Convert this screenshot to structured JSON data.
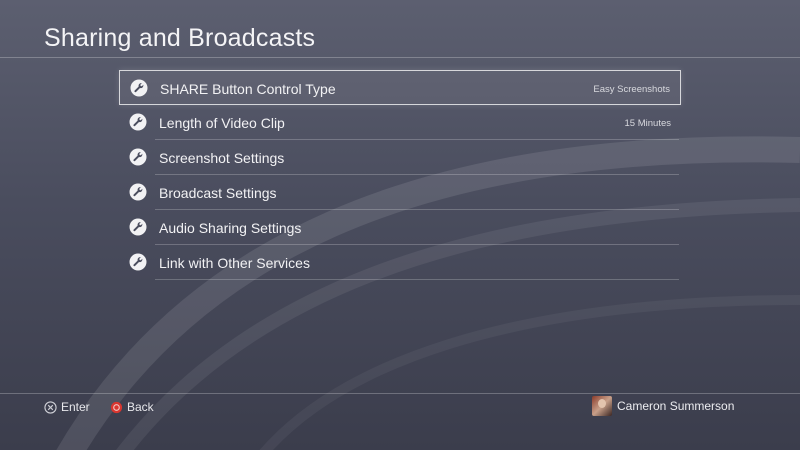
{
  "page": {
    "title": "Sharing and Broadcasts"
  },
  "menu": {
    "items": [
      {
        "label": "SHARE Button Control Type",
        "value": "Easy Screenshots",
        "icon": "wrench-icon",
        "selected": true
      },
      {
        "label": "Length of Video Clip",
        "value": "15 Minutes",
        "icon": "wrench-icon",
        "selected": false
      },
      {
        "label": "Screenshot Settings",
        "value": "",
        "icon": "wrench-icon",
        "selected": false
      },
      {
        "label": "Broadcast Settings",
        "value": "",
        "icon": "wrench-icon",
        "selected": false
      },
      {
        "label": "Audio Sharing Settings",
        "value": "",
        "icon": "wrench-icon",
        "selected": false
      },
      {
        "label": "Link with Other Services",
        "value": "",
        "icon": "wrench-icon",
        "selected": false
      }
    ]
  },
  "footer": {
    "enter_label": "Enter",
    "enter_icon": "cross-button-icon",
    "back_label": "Back",
    "back_icon": "circle-button-icon",
    "back_color": "#d9362f",
    "user_name": "Cameron Summerson"
  },
  "colors": {
    "background_top": "#5c5f70",
    "background_bottom": "#3b3d4c",
    "text": "#f2f2f4"
  }
}
